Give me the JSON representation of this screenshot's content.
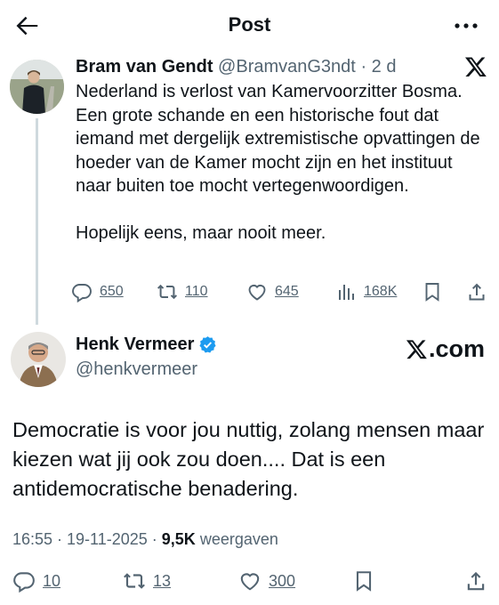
{
  "topbar": {
    "title": "Post"
  },
  "parent": {
    "name": "Bram van Gendt",
    "handle": "@BramvanG3ndt",
    "sep": "·",
    "time": "2 d",
    "text1": "Nederland is verlost van Kamervoorzitter Bosma. Een grote schande en een historische fout dat iemand met dergelijk extremistische opvattingen de hoeder van de Kamer mocht zijn en het instituut naar buiten toe mocht vertegenwoordigen.",
    "text2": "Hopelijk eens, maar nooit meer.",
    "replies": "650",
    "reposts": "110",
    "likes": "645",
    "views": "168K"
  },
  "main": {
    "name": "Henk Vermeer",
    "handle": "@henkvermeer",
    "watermark": ".com",
    "text": "Democratie is voor jou nuttig, zolang mensen maar kiezen wat jij ook zou doen.... Dat is een antidemocratische benadering.",
    "time": "16:55 · 19-11-2025 · ",
    "views_count": "9,5K",
    "views_label": " weergaven",
    "replies": "10",
    "reposts": "13",
    "likes": "300"
  },
  "icons": {
    "back": "arrow-left-icon",
    "more": "more-horizontal-icon",
    "x": "x-logo-icon",
    "reply": "reply-icon",
    "repost": "repost-icon",
    "like": "heart-icon",
    "views": "views-icon",
    "bookmark": "bookmark-icon",
    "share": "share-icon",
    "verified": "verified-badge-icon"
  },
  "colors": {
    "text": "#0f1419",
    "muted": "#536471",
    "verified": "#1d9bf0",
    "thread": "#cfd9de"
  }
}
